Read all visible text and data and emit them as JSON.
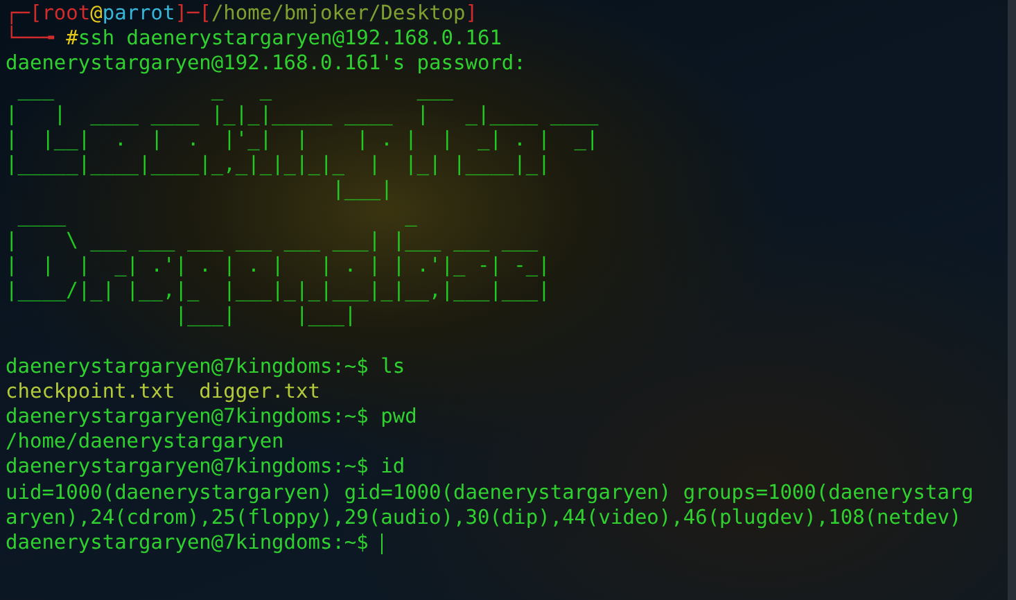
{
  "prompt_line": [
    {
      "text": "┌─[",
      "kind": "frame"
    },
    {
      "text": "root",
      "kind": "user"
    },
    {
      "text": "@",
      "kind": "at"
    },
    {
      "text": "parrot",
      "kind": "host"
    },
    {
      "text": "]─[",
      "kind": "frame"
    },
    {
      "text": "/home/bmjoker/Desktop",
      "kind": "path"
    },
    {
      "text": "]",
      "kind": "frame"
    }
  ],
  "command_line": [
    {
      "text": "└──╼ ",
      "kind": "frame"
    },
    {
      "text": "#",
      "kind": "at"
    },
    {
      "text": "ssh daenerystargaryen@192.168.0.161",
      "kind": "command"
    }
  ],
  "lines": [
    {
      "kind": "output",
      "text": "daenerystargaryen@192.168.0.161's password:"
    },
    {
      "kind": "art",
      "text": " ___             _   _            ___"
    },
    {
      "kind": "art",
      "text": "|   |  ____ ____ |_|_|_____ ____  |   _|____ ____"
    },
    {
      "kind": "art",
      "text": "|  |__|  .  |  .  |'_|  |    | . |  |  _| . |  _|"
    },
    {
      "kind": "art",
      "text": "|_____|____|____|_,_|_|_|_|_  |  |_| |____|_|"
    },
    {
      "kind": "art",
      "text": "                           |___|"
    },
    {
      "kind": "art",
      "text": " ____                            _"
    },
    {
      "kind": "art",
      "text": "|    \\ ___ ___ ___ ___ ___ ___| |___ ___ ___"
    },
    {
      "kind": "art",
      "text": "|  |  |  _| .'| . | . |   | . | | .'|_ -| -_|"
    },
    {
      "kind": "art",
      "text": "|____/|_| |__,|_  |___|_|_|___|_|__,|___|___|"
    },
    {
      "kind": "art",
      "text": "              |___|     |___|"
    },
    {
      "kind": "blank"
    },
    {
      "kind": "output",
      "text": "daenerystargaryen@7kingdoms:~$ ls"
    },
    {
      "kind": "files",
      "text": "checkpoint.txt  digger.txt"
    },
    {
      "kind": "output",
      "text": "daenerystargaryen@7kingdoms:~$ pwd"
    },
    {
      "kind": "output",
      "text": "/home/daenerystargaryen"
    },
    {
      "kind": "output",
      "text": "daenerystargaryen@7kingdoms:~$ id"
    },
    {
      "kind": "output",
      "text": "uid=1000(daenerystargaryen) gid=1000(daenerystargaryen) groups=1000(daenerystarg"
    },
    {
      "kind": "output",
      "text": "aryen),24(cdrom),25(floppy),29(audio),30(dip),44(video),46(plugdev),108(netdev)"
    },
    {
      "kind": "prompt",
      "text": "daenerystargaryen@7kingdoms:~$ "
    }
  ]
}
